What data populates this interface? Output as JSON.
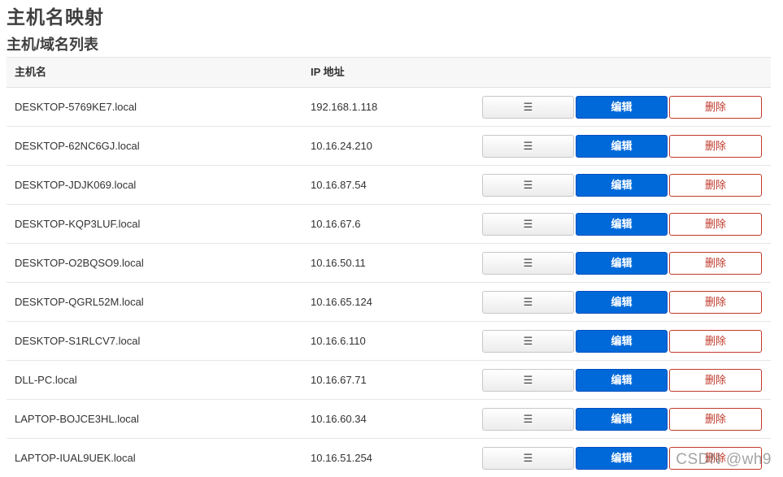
{
  "page": {
    "title": "主机名映射",
    "section_title": "主机/域名列表"
  },
  "table": {
    "headers": {
      "hostname": "主机名",
      "ip": "IP 地址"
    },
    "rows": [
      {
        "hostname": "DESKTOP-5769KE7.local",
        "ip": "192.168.1.118"
      },
      {
        "hostname": "DESKTOP-62NC6GJ.local",
        "ip": "10.16.24.210"
      },
      {
        "hostname": "DESKTOP-JDJK069.local",
        "ip": "10.16.87.54"
      },
      {
        "hostname": "DESKTOP-KQP3LUF.local",
        "ip": "10.16.67.6"
      },
      {
        "hostname": "DESKTOP-O2BQSO9.local",
        "ip": "10.16.50.11"
      },
      {
        "hostname": "DESKTOP-QGRL52M.local",
        "ip": "10.16.65.124"
      },
      {
        "hostname": "DESKTOP-S1RLCV7.local",
        "ip": "10.16.6.110"
      },
      {
        "hostname": "DLL-PC.local",
        "ip": "10.16.67.71"
      },
      {
        "hostname": "LAPTOP-BOJCE3HL.local",
        "ip": "10.16.60.34"
      },
      {
        "hostname": "LAPTOP-IUAL9UEK.local",
        "ip": "10.16.51.254"
      }
    ]
  },
  "actions": {
    "more_label": "☰",
    "edit_label": "编辑",
    "delete_label": "删除"
  },
  "watermark": "CSDN @wh9",
  "colors": {
    "edit": "#0069d9",
    "delete": "#c0392b",
    "header_bg": "#f7f7f7"
  }
}
